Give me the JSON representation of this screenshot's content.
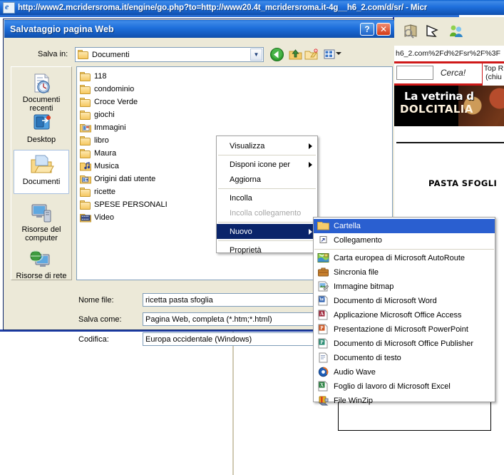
{
  "browser": {
    "title": "http://www2.mcridersroma.it/engine/go.php?to=http://www20.4t_mcridersroma.it-4g__h6_2.com/d/sr/ - Micr",
    "address_fragment": "h6_2.com%2Fd%2Fsr%2F%3F",
    "search_button": "Cerca!",
    "top_label_line1": "Top R",
    "top_label_line2": "(chiu",
    "banner_line1": "La vetrina d",
    "banner_line2": "DOLCITALIA",
    "page_heading": "PASTA SFOGLI",
    "icons": [
      "book-search-icon",
      "pen-icon",
      "people-icon"
    ]
  },
  "dialog": {
    "title": "Salvataggio pagina Web",
    "help_button": "?",
    "close_button": "✕",
    "savein": {
      "label": "Salva in:",
      "value": "Documenti",
      "icon": "folder-document-icon"
    },
    "toolbar": [
      {
        "name": "back-button",
        "icon": "back-arrow-icon"
      },
      {
        "name": "up-one-level-button",
        "icon": "up-folder-icon"
      },
      {
        "name": "create-new-folder-button",
        "icon": "new-folder-icon"
      },
      {
        "name": "views-button",
        "icon": "views-icon"
      }
    ],
    "places": [
      {
        "label": "Documenti recenti",
        "icon": "recent-documents-icon",
        "selected": false
      },
      {
        "label": "Desktop",
        "icon": "desktop-icon",
        "selected": false
      },
      {
        "label": "Documenti",
        "icon": "my-documents-icon",
        "selected": true
      },
      {
        "label": "Risorse del computer",
        "icon": "my-computer-icon",
        "selected": false
      },
      {
        "label": "Risorse di rete",
        "icon": "network-places-icon",
        "selected": false
      }
    ],
    "files": [
      {
        "name": "118",
        "icon": "folder-icon"
      },
      {
        "name": "condominio",
        "icon": "folder-icon"
      },
      {
        "name": "Croce Verde",
        "icon": "folder-icon"
      },
      {
        "name": "giochi",
        "icon": "folder-icon"
      },
      {
        "name": "Immagini",
        "icon": "pictures-folder-icon"
      },
      {
        "name": "libro",
        "icon": "folder-icon"
      },
      {
        "name": "Maura",
        "icon": "folder-icon"
      },
      {
        "name": "Musica",
        "icon": "music-folder-icon"
      },
      {
        "name": "Origini dati utente",
        "icon": "datasource-folder-icon"
      },
      {
        "name": "ricette",
        "icon": "folder-icon"
      },
      {
        "name": "SPESE PERSONALI",
        "icon": "folder-icon"
      },
      {
        "name": "Video",
        "icon": "video-folder-icon"
      }
    ],
    "fields": {
      "filename_label": "Nome file:",
      "filename_value": "ricetta pasta sfoglia",
      "savetype_label": "Salva come:",
      "savetype_value": "Pagina Web, completa (*.htm;*.html)",
      "encoding_label": "Codifica:",
      "encoding_value": "Europa occidentale (Windows)"
    }
  },
  "context_menu": {
    "items": [
      {
        "label": "Visualizza",
        "submenu": true,
        "disabled": false,
        "highlight": false
      },
      {
        "sep": true
      },
      {
        "label": "Disponi icone per",
        "submenu": true,
        "disabled": false,
        "highlight": false
      },
      {
        "label": "Aggiorna",
        "submenu": false,
        "disabled": false,
        "highlight": false
      },
      {
        "sep": true
      },
      {
        "label": "Incolla",
        "submenu": false,
        "disabled": false,
        "highlight": false
      },
      {
        "label": "Incolla collegamento",
        "submenu": false,
        "disabled": true,
        "highlight": false
      },
      {
        "sep": true
      },
      {
        "label": "Nuovo",
        "submenu": true,
        "disabled": false,
        "highlight": true
      },
      {
        "sep": true
      },
      {
        "label": "Proprietà",
        "submenu": false,
        "disabled": false,
        "highlight": false
      }
    ]
  },
  "submenu": {
    "items": [
      {
        "label": "Cartella",
        "icon": "folder-icon",
        "highlight": true,
        "accel": "C"
      },
      {
        "label": "Collegamento",
        "icon": "shortcut-icon",
        "highlight": false,
        "accel": "l"
      },
      {
        "sep": true
      },
      {
        "label": "Carta europea di Microsoft AutoRoute",
        "icon": "autoroute-icon",
        "highlight": false
      },
      {
        "label": "Sincronia file",
        "icon": "briefcase-icon",
        "highlight": false
      },
      {
        "label": "Immagine bitmap",
        "icon": "bitmap-icon",
        "highlight": false
      },
      {
        "label": "Documento di Microsoft Word",
        "icon": "word-icon",
        "highlight": false
      },
      {
        "label": "Applicazione Microsoft Office Access",
        "icon": "access-icon",
        "highlight": false
      },
      {
        "label": "Presentazione di Microsoft PowerPoint",
        "icon": "powerpoint-icon",
        "highlight": false
      },
      {
        "label": "Documento di Microsoft Office Publisher",
        "icon": "publisher-icon",
        "highlight": false
      },
      {
        "label": "Documento di testo",
        "icon": "text-document-icon",
        "highlight": false
      },
      {
        "label": "Audio Wave",
        "icon": "wave-audio-icon",
        "highlight": false
      },
      {
        "label": "Foglio di lavoro di Microsoft Excel",
        "icon": "excel-icon",
        "highlight": false
      },
      {
        "label": "File WinZip",
        "icon": "winzip-icon",
        "highlight": false
      }
    ]
  },
  "colors": {
    "titlebar_blue": "#1e6fdc",
    "dialog_face": "#ece9d8",
    "menu_highlight": "#0a246a",
    "submenu_highlight": "#2a5fd0",
    "accent_red": "#cf1919"
  }
}
